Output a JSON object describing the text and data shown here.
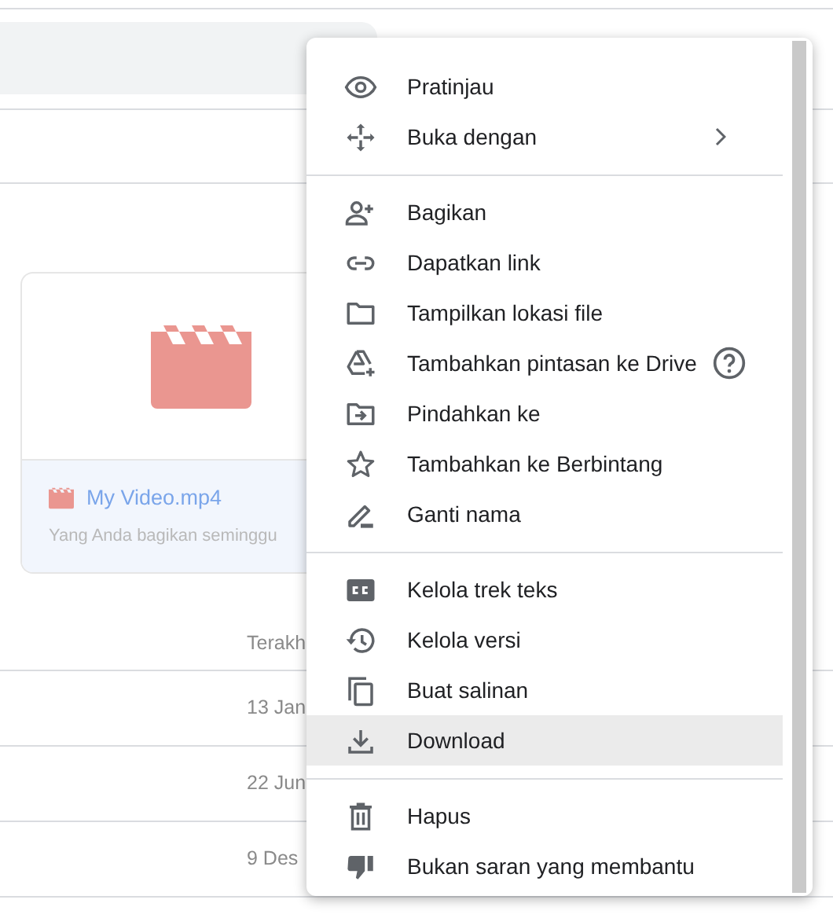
{
  "background": {
    "card": {
      "file_name": "My Video.mp4",
      "subtitle": "Yang Anda bagikan seminggu"
    },
    "table": {
      "header": "Terakh",
      "rows": [
        {
          "date": "13 Jan"
        },
        {
          "date": "22 Jun"
        },
        {
          "date": "9 Des"
        }
      ]
    }
  },
  "context_menu": {
    "sections": [
      {
        "items": [
          {
            "label": "Pratinjau",
            "kind": "eye",
            "selected": false
          },
          {
            "label": "Buka dengan",
            "kind": "move",
            "submenu": true,
            "selected": false
          }
        ]
      },
      {
        "items": [
          {
            "label": "Bagikan",
            "kind": "share",
            "selected": false
          },
          {
            "label": "Dapatkan link",
            "kind": "link",
            "selected": false
          },
          {
            "label": "Tampilkan lokasi file",
            "kind": "folder",
            "selected": false
          },
          {
            "label": "Tambahkan pintasan ke Drive",
            "kind": "shortcut",
            "help": true,
            "selected": false
          },
          {
            "label": "Pindahkan ke",
            "kind": "relocate",
            "selected": false
          },
          {
            "label": "Tambahkan ke Berbintang",
            "kind": "star",
            "selected": false
          },
          {
            "label": "Ganti nama",
            "kind": "rename",
            "selected": false
          }
        ]
      },
      {
        "items": [
          {
            "label": "Kelola trek teks",
            "kind": "captions",
            "selected": false
          },
          {
            "label": "Kelola versi",
            "kind": "history",
            "selected": false
          },
          {
            "label": "Buat salinan",
            "kind": "copy",
            "selected": false
          },
          {
            "label": "Download",
            "kind": "download",
            "selected": true
          }
        ]
      },
      {
        "items": [
          {
            "label": "Hapus",
            "kind": "trash",
            "selected": false
          },
          {
            "label": "Bukan saran yang membantu",
            "kind": "dislike",
            "selected": false
          }
        ]
      }
    ]
  }
}
